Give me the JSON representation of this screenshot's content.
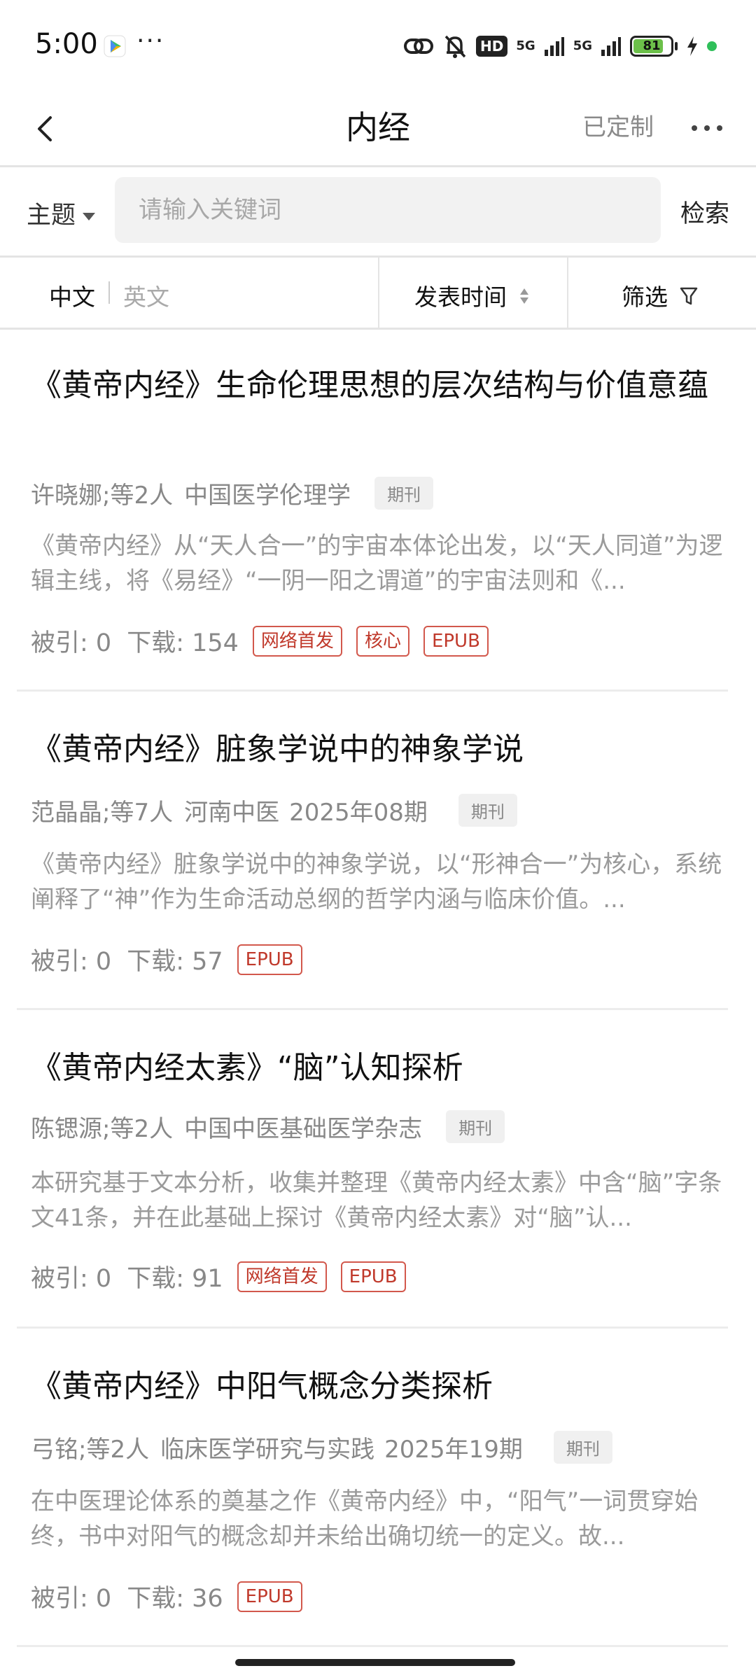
{
  "status_bar": {
    "time": "5:00",
    "dots": "···",
    "hd": "HD",
    "net1": "5G",
    "net2": "5G",
    "battery_level": "81",
    "battery_fraction": 0.81
  },
  "header": {
    "title": "内经",
    "customized_label": "已定制"
  },
  "search": {
    "topic_label": "主题",
    "placeholder": "请输入关键词",
    "button_label": "检索"
  },
  "filters": {
    "lang_zh": "中文",
    "lang_en": "英文",
    "sort_label": "发表时间",
    "filter_label": "筛选"
  },
  "articles": [
    {
      "title": "《黄帝内经》生命伦理思想的层次结构与价值意蕴",
      "authors": "许晓娜;等2人",
      "journal": "中国医学伦理学",
      "issue": "",
      "type": "期刊",
      "abstract": "《黄帝内经》从“天人合一”的宇宙本体论出发，以“天人同道”为逻辑主线，将《易经》“一阴一阳之谓道”的宇宙法则和《...",
      "cited": "被引: 0",
      "downloads": "下载: 154",
      "badges": [
        "网络首发",
        "核心",
        "EPUB"
      ]
    },
    {
      "title": "《黄帝内经》脏象学说中的神象学说",
      "authors": "范晶晶;等7人",
      "journal": "河南中医",
      "issue": "2025年08期",
      "type": "期刊",
      "abstract": "《黄帝内经》脏象学说中的神象学说，以“形神合一”为核心，系统阐释了“神”作为生命活动总纲的哲学内涵与临床价值。...",
      "cited": "被引: 0",
      "downloads": "下载: 57",
      "badges": [
        "EPUB"
      ]
    },
    {
      "title": "《黄帝内经太素》“脑”认知探析",
      "authors": "陈锶源;等2人",
      "journal": "中国中医基础医学杂志",
      "issue": "",
      "type": "期刊",
      "abstract": "本研究基于文本分析，收集并整理《黄帝内经太素》中含“脑”字条文41条，并在此基础上探讨《黄帝内经太素》对“脑”认...",
      "cited": "被引: 0",
      "downloads": "下载: 91",
      "badges": [
        "网络首发",
        "EPUB"
      ]
    },
    {
      "title": "《黄帝内经》中阳气概念分类探析",
      "authors": "弓铭;等2人",
      "journal": "临床医学研究与实践",
      "issue": "2025年19期",
      "type": "期刊",
      "abstract": "在中医理论体系的奠基之作《黄帝内经》中，“阳气”一词贯穿始终，书中对阳气的概念却并未给出确切统一的定义。故...",
      "cited": "被引: 0",
      "downloads": "下载: 36",
      "badges": [
        "EPUB"
      ]
    }
  ]
}
